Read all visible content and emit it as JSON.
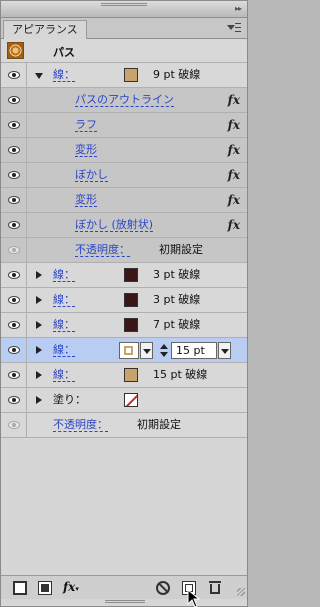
{
  "panel": {
    "tab_label": "アピアランス",
    "target": "パス"
  },
  "rows": {
    "stroke_main": {
      "label": "線：",
      "value": "9 pt 破線",
      "swatch_color": "#c9a36c"
    },
    "effect_1": "パスのアウトライン",
    "effect_2": "ラフ",
    "effect_3": "変形",
    "effect_4": "ぼかし",
    "effect_5": "変形",
    "effect_6": "ぼかし (放射状)",
    "opacity_inner": {
      "label": "不透明度：",
      "value": "初期設定"
    },
    "stroke_2": {
      "label": "線：",
      "value": "3 pt 破線",
      "swatch_color": "#3a1616"
    },
    "stroke_3": {
      "label": "線：",
      "value": "3 pt 破線",
      "swatch_color": "#3a1616"
    },
    "stroke_4": {
      "label": "線：",
      "value": "7 pt 破線",
      "swatch_color": "#3a1616"
    },
    "stroke_selected": {
      "label": "線：",
      "weight": "15 pt"
    },
    "stroke_6": {
      "label": "線：",
      "value": "15 pt 破線",
      "swatch_color": "#c9a36c"
    },
    "fill": {
      "label": "塗り："
    },
    "opacity_outer": {
      "label": "不透明度：",
      "value": "初期設定"
    }
  },
  "fx_symbol": "fx",
  "toolbar": {
    "fx_label": "fx"
  },
  "colors": {
    "link": "#2b45c9",
    "selected_row": "#b9cdf3"
  }
}
